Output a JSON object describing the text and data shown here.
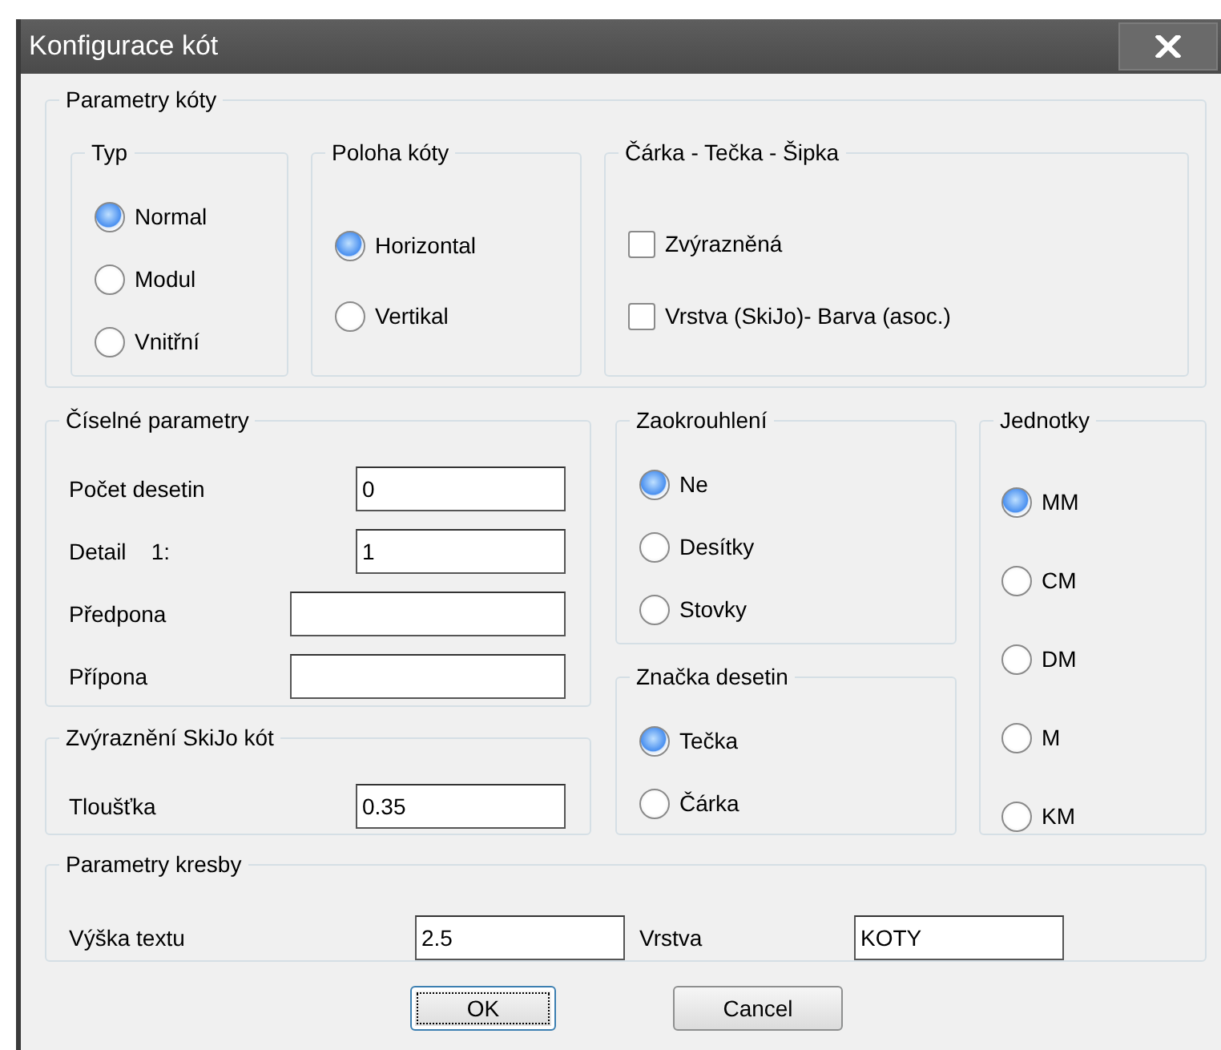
{
  "window": {
    "title": "Konfigurace kót"
  },
  "parametry_koty": {
    "title": "Parametry kóty",
    "typ": {
      "title": "Typ",
      "options": [
        {
          "label": "Normal",
          "selected": true
        },
        {
          "label": "Modul",
          "selected": false
        },
        {
          "label": "Vnitřní",
          "selected": false
        }
      ]
    },
    "poloha_koty": {
      "title": "Poloha kóty",
      "options": [
        {
          "label": "Horizontal",
          "selected": true
        },
        {
          "label": "Vertikal",
          "selected": false
        }
      ]
    },
    "carka_tecka_sipka": {
      "title": "Čárka - Tečka - Šipka",
      "checkboxes": [
        {
          "label": "Zvýrazněná",
          "checked": false
        },
        {
          "label": "Vrstva (SkiJo)- Barva (asoc.)",
          "checked": false
        }
      ]
    }
  },
  "ciselne_parametry": {
    "title": "Číselné parametry",
    "fields": [
      {
        "label": "Počet desetin",
        "value": "0",
        "kind": "short"
      },
      {
        "label": "Detail    1:",
        "value": "1",
        "kind": "short"
      },
      {
        "label": "Předpona",
        "kind": "long"
      },
      {
        "label": "Přípona",
        "kind": "long"
      }
    ]
  },
  "zvyrazneni_skijo_kot": {
    "title": "Zvýraznění SkiJo kót",
    "fields": [
      {
        "label": "Tloušťka",
        "value": "0.35"
      }
    ]
  },
  "zaokrouhleni": {
    "title": "Zaokrouhlení",
    "options": [
      {
        "label": "Ne",
        "selected": true
      },
      {
        "label": "Desítky",
        "selected": false
      },
      {
        "label": "Stovky",
        "selected": false
      }
    ]
  },
  "znacka_desetin": {
    "title": "Značka desetin",
    "options": [
      {
        "label": "Tečka",
        "selected": true
      },
      {
        "label": "Čárka",
        "selected": false
      }
    ]
  },
  "jednotky": {
    "title": "Jednotky",
    "options": [
      {
        "label": "MM",
        "selected": true
      },
      {
        "label": "CM",
        "selected": false
      },
      {
        "label": "DM",
        "selected": false
      },
      {
        "label": "M",
        "selected": false
      },
      {
        "label": "KM",
        "selected": false
      }
    ]
  },
  "parametry_kresby": {
    "title": "Parametry kresby",
    "fields": [
      {
        "label": "Výška textu",
        "value": "2.5"
      },
      {
        "label": "Vrstva",
        "value": "KOTY"
      }
    ]
  },
  "buttons": [
    {
      "label": "OK",
      "default": true
    },
    {
      "label": "Cancel",
      "default": false
    }
  ]
}
